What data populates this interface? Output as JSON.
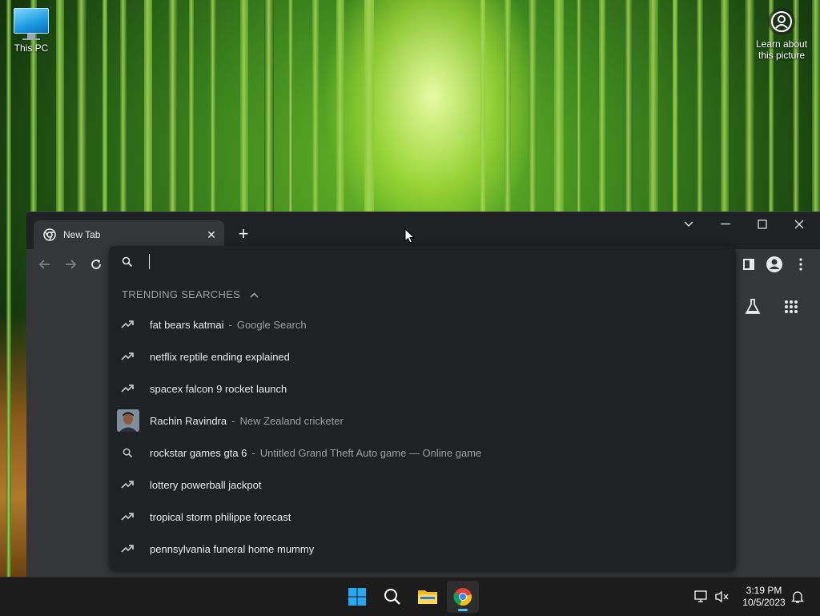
{
  "desktop": {
    "icons": [
      {
        "label": "This PC"
      },
      {
        "label": "Learn about this picture"
      }
    ]
  },
  "browser": {
    "tab": {
      "title": "New Tab"
    },
    "omnibox": {
      "value": "",
      "section_header": "TRENDING SEARCHES",
      "suggestions": [
        {
          "icon": "trending-icon",
          "main": "fat bears katmai",
          "desc": "Google Search"
        },
        {
          "icon": "trending-icon",
          "main": "netflix reptile ending explained",
          "desc": ""
        },
        {
          "icon": "trending-icon",
          "main": "spacex falcon 9 rocket launch",
          "desc": ""
        },
        {
          "icon": "person-thumbnail",
          "main": "Rachin Ravindra",
          "desc": "New Zealand cricketer"
        },
        {
          "icon": "search-icon",
          "main": "rockstar games gta 6",
          "desc": "Untitled Grand Theft Auto game — Online game"
        },
        {
          "icon": "trending-icon",
          "main": "lottery powerball jackpot",
          "desc": ""
        },
        {
          "icon": "trending-icon",
          "main": "tropical storm philippe forecast",
          "desc": ""
        },
        {
          "icon": "trending-icon",
          "main": "pennsylvania funeral home mummy",
          "desc": ""
        }
      ],
      "separator": "-"
    }
  },
  "taskbar": {
    "apps": [
      "start-button",
      "search-button",
      "file-explorer",
      "chrome"
    ],
    "active_app": "chrome",
    "clock": {
      "time": "3:19 PM",
      "date": "10/5/2023"
    }
  },
  "colors": {
    "accent": "#4cc2ff",
    "browser_bg": "#202124",
    "toolbar_bg": "#35363a",
    "text_primary": "#e8eaed",
    "text_secondary": "#9aa0a6"
  }
}
